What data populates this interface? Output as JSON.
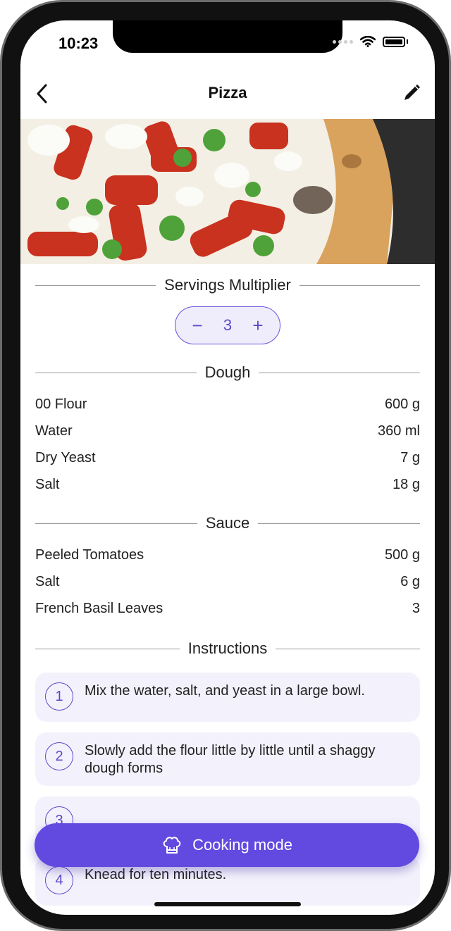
{
  "status": {
    "time": "10:23"
  },
  "nav": {
    "title": "Pizza"
  },
  "servings": {
    "label": "Servings Multiplier",
    "value": "3",
    "minus": "−",
    "plus": "+"
  },
  "sections": {
    "dough": {
      "title": "Dough",
      "items": [
        {
          "name": "00 Flour",
          "amount": "600 g"
        },
        {
          "name": "Water",
          "amount": "360 ml"
        },
        {
          "name": "Dry Yeast",
          "amount": "7 g"
        },
        {
          "name": "Salt",
          "amount": "18 g"
        }
      ]
    },
    "sauce": {
      "title": "Sauce",
      "items": [
        {
          "name": "Peeled Tomatoes",
          "amount": "500 g"
        },
        {
          "name": "Salt",
          "amount": "6 g"
        },
        {
          "name": "French Basil Leaves",
          "amount": "3"
        }
      ]
    }
  },
  "instructions": {
    "title": "Instructions",
    "steps": [
      {
        "num": "1",
        "text": "Mix the water, salt, and yeast in a large bowl."
      },
      {
        "num": "2",
        "text": "Slowly add the flour little by little until a shaggy dough forms"
      },
      {
        "num": "3",
        "text": ""
      },
      {
        "num": "4",
        "text": "Knead for ten minutes."
      }
    ]
  },
  "cooking_mode": {
    "label": "Cooking mode"
  },
  "colors": {
    "accent": "#6249e0",
    "accent_light": "#efedfb",
    "card": "#f3f2fc"
  },
  "icons": {
    "back": "chevron-left-icon",
    "edit": "pencil-icon",
    "chef": "chef-hat-icon",
    "wifi": "wifi-icon",
    "battery": "battery-icon"
  }
}
